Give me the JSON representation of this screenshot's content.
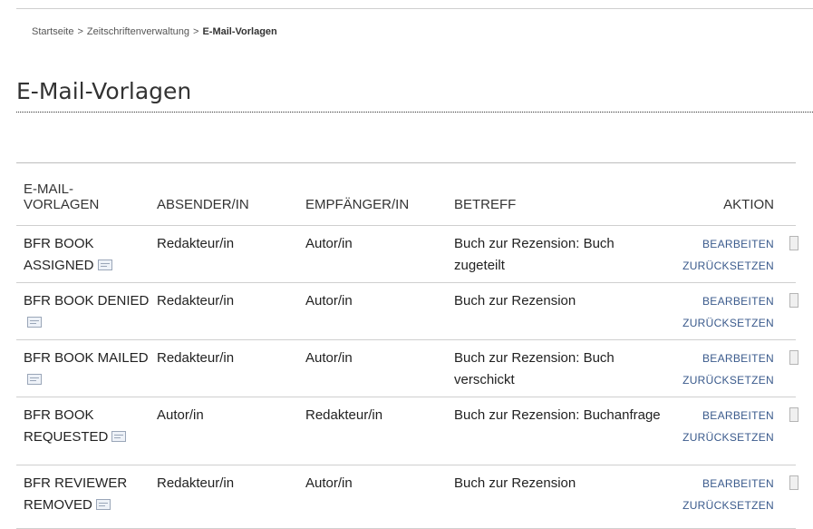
{
  "breadcrumb": {
    "items": [
      "Startseite",
      "Zeitschriftenverwaltung"
    ],
    "separator": ">",
    "current": "E-Mail-Vorlagen"
  },
  "page_title": "E-Mail-Vorlagen",
  "table": {
    "headers": {
      "templates": "E-MAIL-\nVORLAGEN",
      "sender": "ABSENDER/IN",
      "recipient": "EMPFÄNGER/IN",
      "subject": "BETREFF",
      "action": "AKTION"
    },
    "rows": [
      {
        "name": "BFR BOOK ASSIGNED",
        "sender": "Redakteur/in",
        "recipient": "Autor/in",
        "subject": "Buch zur Rezension: Buch zugeteilt",
        "edit": "BEARBEITEN",
        "reset": "ZURÜCKSETZEN"
      },
      {
        "name": "BFR BOOK DENIED",
        "sender": "Redakteur/in",
        "recipient": "Autor/in",
        "subject": "Buch zur Rezension",
        "edit": "BEARBEITEN",
        "reset": "ZURÜCKSETZEN"
      },
      {
        "name": "BFR BOOK MAILED",
        "sender": "Redakteur/in",
        "recipient": "Autor/in",
        "subject": "Buch zur Rezension: Buch verschickt",
        "edit": "BEARBEITEN",
        "reset": "ZURÜCKSETZEN"
      },
      {
        "name": "BFR BOOK REQUESTED",
        "sender": "Autor/in",
        "recipient": "Redakteur/in",
        "subject": "Buch zur Rezension: Buchanfrage",
        "edit": "BEARBEITEN",
        "reset": "ZURÜCKSETZEN"
      },
      {
        "name": "BFR REVIEWER REMOVED",
        "sender": "Redakteur/in",
        "recipient": "Autor/in",
        "subject": "Buch zur Rezension",
        "edit": "BEARBEITEN",
        "reset": "ZURÜCKSETZEN"
      }
    ]
  },
  "icons": {
    "template_icon": "mail-preview-icon",
    "row_toggle": "checkbox-icon"
  },
  "colors": {
    "link": "#3a5a8c",
    "text": "#222222",
    "rule": "#cfcfcf"
  }
}
